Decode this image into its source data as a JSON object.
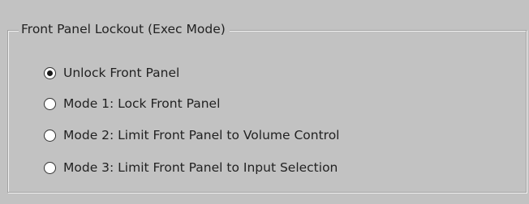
{
  "group": {
    "title": "Front Panel Lockout (Exec Mode)"
  },
  "options": [
    {
      "label": "Unlock Front Panel",
      "selected": true
    },
    {
      "label": "Mode 1: Lock Front Panel",
      "selected": false
    },
    {
      "label": "Mode 2: Limit Front Panel to Volume Control",
      "selected": false
    },
    {
      "label": "Mode 3: Limit Front Panel to Input Selection",
      "selected": false
    }
  ],
  "colors": {
    "background": "#c2c2c2",
    "text": "#222222",
    "radio_fill": "#ffffff",
    "radio_dot": "#1a1a1a"
  }
}
